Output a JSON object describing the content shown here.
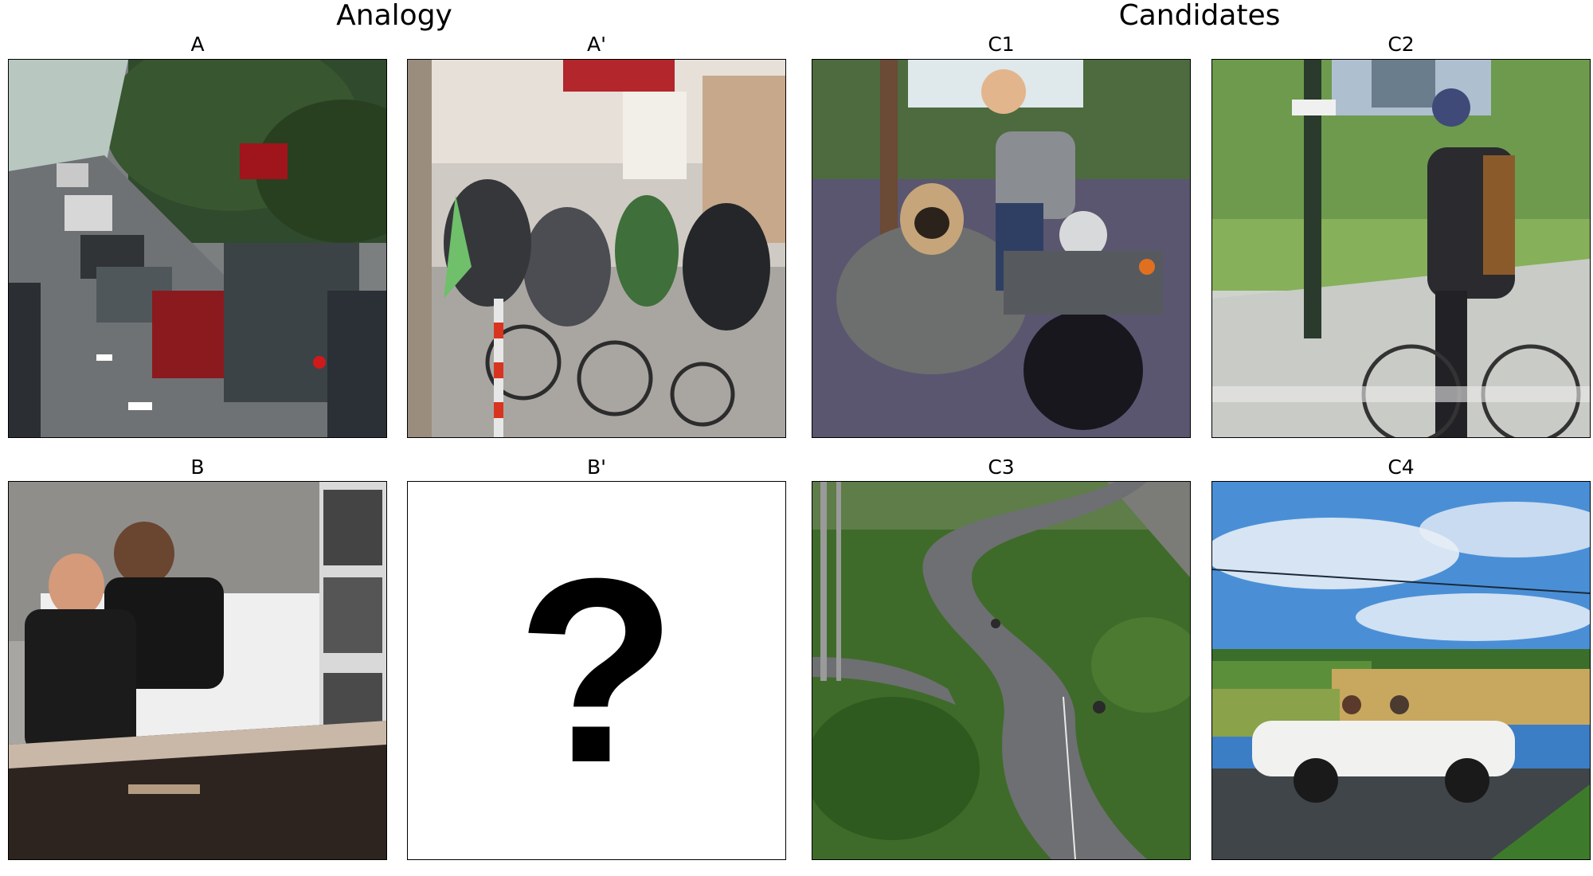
{
  "sections": {
    "analogy": "Analogy",
    "candidates": "Candidates"
  },
  "labels": {
    "a": "A",
    "a_prime": "A'",
    "b": "B",
    "b_prime": "B'",
    "c1": "C1",
    "c2": "C2",
    "c3": "C3",
    "c4": "C4"
  },
  "placeholder": "?",
  "images": {
    "a": "traffic jam of cars on a highway",
    "a_prime": "cyclists and scooter riders on a city street",
    "b": "two men riding in a convertible car",
    "c1": "man on a motorcycle with a pug in the sidecar",
    "c2": "man in a suit riding a bicycle in a park",
    "c3": "cyclists on a winding paved path",
    "c4": "two people in a white convertible on a country road"
  }
}
